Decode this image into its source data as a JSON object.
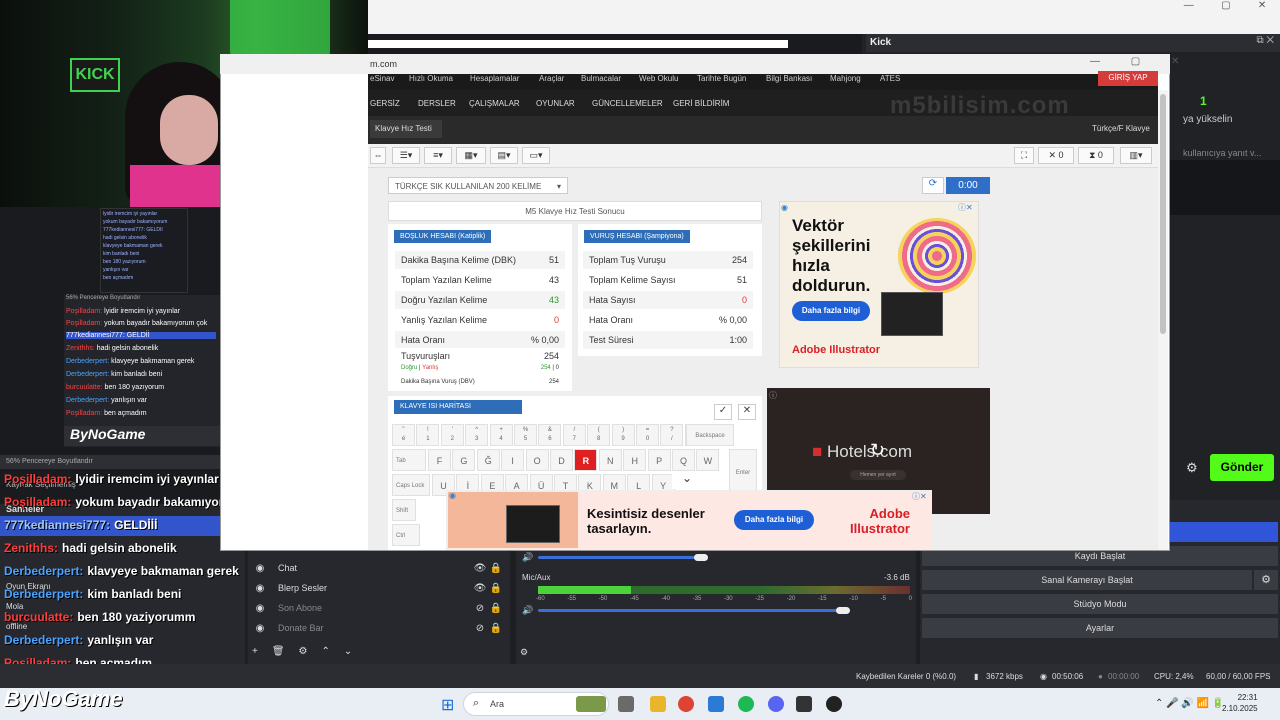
{
  "obs": {
    "window_controls": [
      "—",
      "▢",
      "✕"
    ],
    "kick_panel": {
      "title": "Kick",
      "controls": "⧉ ✕",
      "viewer_count": "1",
      "message_fragment": "ya yükselin",
      "message_fragment2": "kullanıcıya yanıt v...",
      "send_label": "Gönder"
    },
    "webcam_sign": "KICK",
    "mini_preview_lines": [
      "lyidir iremcim iyi yayınlar",
      "yokum bayadır bakamıyorum",
      "777kediannesi777: GELDİİ",
      "hadi gelsin abonelik",
      "klavyeye bakmaman gerek",
      "kim banladı beni",
      "ben 180 yazıyorum",
      "yanlışın var",
      "ben açmadım"
    ],
    "mini_zoom": "56%   Pencereye Boyutlandır",
    "mini_logo": "ByNoGame",
    "mini_chat": [
      {
        "user": "Poşilladam:",
        "text": "lyidir iremcim iyi yayınlar"
      },
      {
        "user": "Poşilladam:",
        "text": "yokum bayadır bakamıyorum çok"
      },
      {
        "user": "777kediannesi777:",
        "text": "GELDİİ"
      },
      {
        "user": "Zenithhs:",
        "text": "hadi gelsin abonelik"
      },
      {
        "user": "Derbederpert:",
        "text": "klavyeye bakmaman gerek"
      },
      {
        "user": "Derbederpert:",
        "text": "kim banladı beni"
      },
      {
        "user": "burcuulatte:",
        "text": "ben 180 yazıyorum"
      },
      {
        "user": "Derbederpert:",
        "text": "yanlışın var"
      },
      {
        "user": "Poşilladam:",
        "text": "ben açmadım"
      }
    ],
    "zoom_text": "56%      Pencereye Boyutlandır",
    "chat": [
      {
        "user": "Poşilladam:",
        "text": "lyidir iremcim iyi yayınlar",
        "color": "#ff3b3b"
      },
      {
        "user": "Poşilladam:",
        "text": "yokum bayadır bakamıyorum çok",
        "color": "#ff3b3b"
      },
      {
        "user": "777kediannesi777:",
        "text": "GELDİİİ",
        "color": "#9cc8ff"
      },
      {
        "user": "Zenithhs:",
        "text": "hadi gelsin abonelik",
        "color": "#ff3b3b"
      },
      {
        "user": "Derbederpert:",
        "text": "klavyeye bakmaman gerek",
        "color": "#4aa3ff"
      },
      {
        "user": "Derbederpert:",
        "text": "kim banladı beni",
        "color": "#4aa3ff"
      },
      {
        "user": "burcuulatte:",
        "text": "ben 180 yaziyorumm",
        "color": "#ff3b3b"
      },
      {
        "user": "Derbederpert:",
        "text": "yanlışın var",
        "color": "#4aa3ff"
      },
      {
        "user": "Poşilladam:",
        "text": "ben açmadım",
        "color": "#ff3b3b"
      }
    ],
    "scenes": {
      "header": "Sahneler",
      "source_label": "Kaynak Seçilmemiş",
      "items": [
        "Oyun Ekranı",
        "Mola",
        "offline"
      ]
    },
    "sources": [
      {
        "name": "Chat",
        "dim": false
      },
      {
        "name": "Blerp Sesler",
        "dim": false
      },
      {
        "name": "Son Abone",
        "dim": true
      },
      {
        "name": "Donate Bar",
        "dim": true
      }
    ],
    "source_toolbar": [
      "+",
      "🗑",
      "⚙",
      "⌃",
      "⌄"
    ],
    "mixer": {
      "channel": "Mic/Aux",
      "db": "-3.6 dB",
      "scale": [
        "-60",
        "-55",
        "-50",
        "-45",
        "-40",
        "-35",
        "-30",
        "-25",
        "-20",
        "-15",
        "-10",
        "-5",
        "0"
      ],
      "mic_level": 0.25,
      "desktop_volume": 0.45,
      "mic_volume": 0.84
    },
    "controls": [
      "Kaydı Başlat",
      "Sanal Kamerayı Başlat",
      "Stüdyo Modu",
      "Ayarlar"
    ],
    "status": {
      "dropped": "Kaybedilen Kareler 0 (%0.0)",
      "bitrate": "3672 kbps",
      "stream_time": "00:50:06",
      "rec_time": "00:00:00",
      "cpu": "CPU: 2,4%",
      "fps": "60,00 / 60,00 FPS"
    },
    "brand": "ByNoGame"
  },
  "browser": {
    "title": "m.com",
    "window_controls": "— ▢ ✕",
    "menu": [
      "eSinav",
      "Hızlı Okuma",
      "Hesaplamalar",
      "Araçlar",
      "Bulmacalar",
      "Web Okulu",
      "Tarihte Bugün",
      "Bilgi Bankası",
      "Mahjong",
      "ATES"
    ],
    "login": "GİRİŞ YAP",
    "nav": [
      "GERSİZ",
      "DERSLER",
      "ÇALIŞMALAR",
      "OYUNLAR",
      "GÜNCELLEMELER",
      "GERİ BİLDİRİM"
    ],
    "watermark": "m5bilisim.com",
    "crumb": "Klavye Hız Testi",
    "crumb_right": "Türkçe/F Klavye",
    "toolbar_counts": {
      "errors": "0",
      "time": "0"
    },
    "wordset": "TÜRKÇE SIK KULLANILAN 200 KELİME",
    "timer": "0:00",
    "result_title": "M5 Klavye Hız Testi Sonucu",
    "space_card": {
      "tag": "BOŞLUK HESABI (Katiplik)",
      "rows": [
        {
          "label": "Dakika Başına Kelime (DBK)",
          "value": "51"
        },
        {
          "label": "Toplam Yazılan Kelime",
          "value": "43"
        },
        {
          "label": "Doğru Yazılan Kelime",
          "value": "43"
        },
        {
          "label": "Yanlış Yazılan Kelime",
          "value": "0"
        },
        {
          "label": "Hata Oranı",
          "value": "% 0,00"
        }
      ],
      "strokes_label": "Tuşvuruşları",
      "strokes_value": "254",
      "correct_label": "Doğru",
      "wrong_label": "Yanlış",
      "correct_value": "254",
      "wrong_value": "0",
      "dbv_label": "Dakika Başına Vuruş (DBV)",
      "dbv_value": "254"
    },
    "stroke_card": {
      "tag": "VURUŞ HESABI (Şampiyona)",
      "rows": [
        {
          "label": "Toplam Tuş Vuruşu",
          "value": "254"
        },
        {
          "label": "Toplam Kelime Sayısı",
          "value": "51"
        },
        {
          "label": "Hata Sayısı",
          "value": "0"
        },
        {
          "label": "Hata Oranı",
          "value": "% 0,00"
        },
        {
          "label": "Test Süresi",
          "value": "1:00"
        }
      ]
    },
    "heatmap_tag": "KLAVYE ISI HARİTASI",
    "keyboard": {
      "row1": [
        [
          "\"",
          "é"
        ],
        [
          "!",
          "1"
        ],
        [
          "'",
          "2"
        ],
        [
          "^",
          "3"
        ],
        [
          "+",
          "4"
        ],
        [
          "%",
          "5"
        ],
        [
          "&",
          "6"
        ],
        [
          "/",
          "7"
        ],
        [
          "(",
          "8"
        ],
        [
          ")",
          "9"
        ],
        [
          "=",
          "0"
        ],
        [
          "?",
          "/"
        ],
        [
          "_",
          "-"
        ]
      ],
      "backspace": "Backspace",
      "tab": "Tab",
      "row2": [
        "F",
        "G",
        "Ğ",
        "I",
        "O",
        "D",
        "R",
        "N",
        "H",
        "P",
        "Q",
        "W"
      ],
      "hot_key": "R",
      "enter": "Enter",
      "caps": "Caps Lock",
      "row3": [
        "U",
        "İ",
        "E",
        "A",
        "Ü",
        "T",
        "K",
        "M",
        "L",
        "Y"
      ],
      "shift": "Shift",
      "ctrl": "Ctrl"
    },
    "ad1": {
      "title": "Vektör şekillerini hızla doldurun.",
      "button": "Daha fazla bilgi",
      "brand": "Adobe Illustrator"
    },
    "ad2": {
      "title": "Hotels.com",
      "sub": "Hemen yer ayırt"
    },
    "ad3": {
      "title": "Kesintisiz desenler tasarlayın.",
      "button": "Daha fazla bilgi",
      "brand": "Adobe Illustrator"
    }
  },
  "taskbar": {
    "search": "Ara",
    "time": "22:31",
    "date": "2.10.2025",
    "tray": "⌃  🎤  🔊  📶  🔋"
  }
}
